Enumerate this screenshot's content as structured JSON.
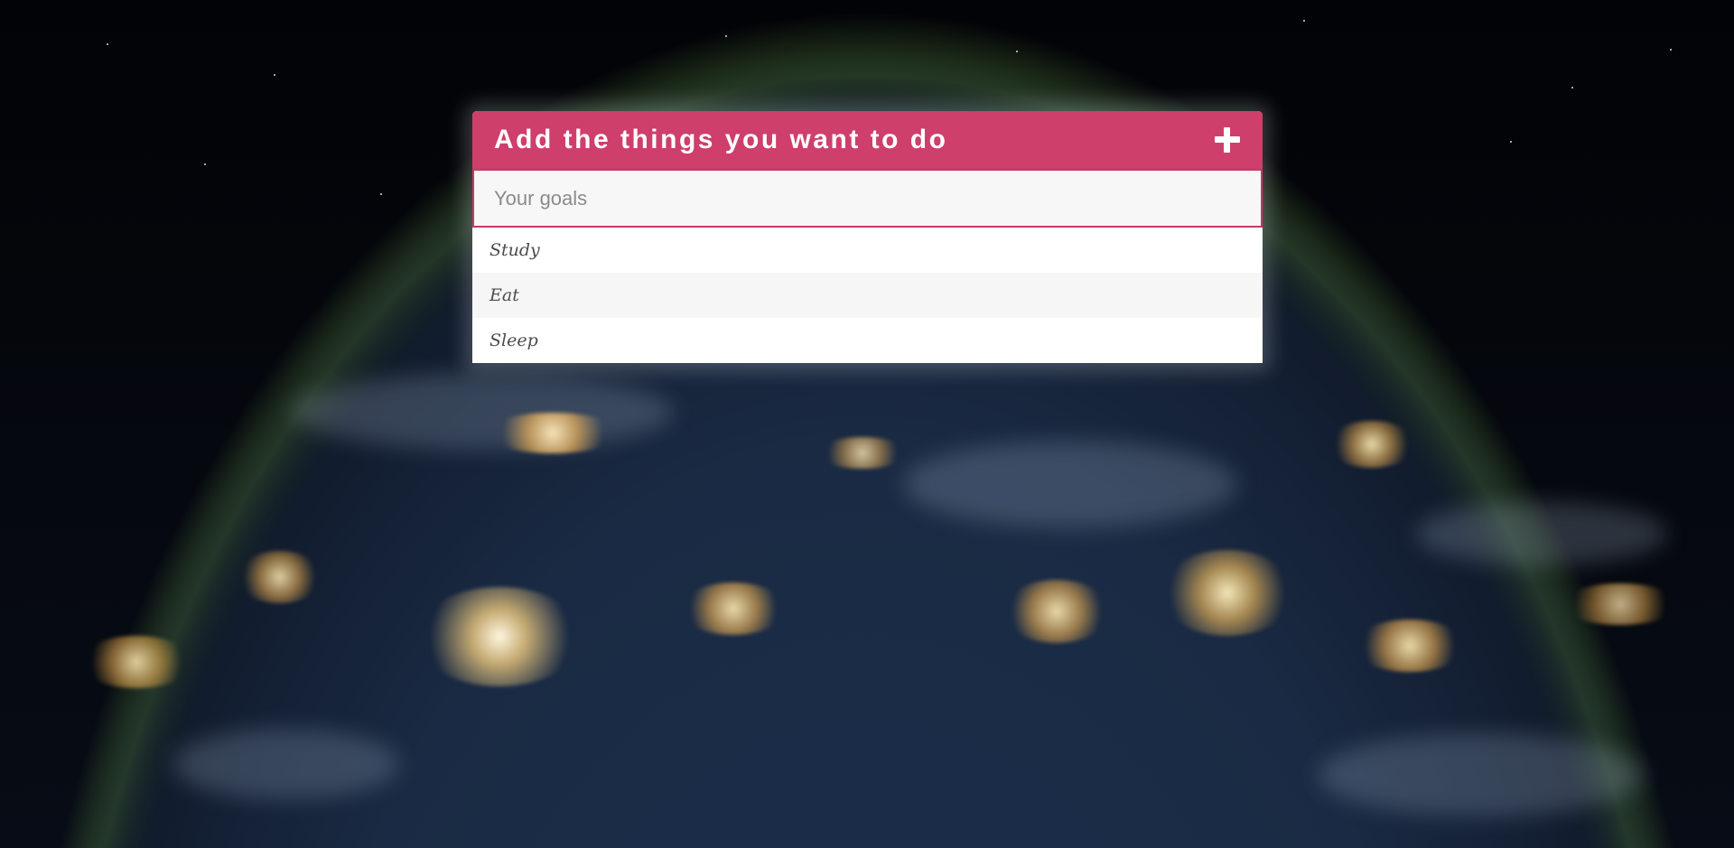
{
  "app": {
    "background_description_image": "night-earth-lights"
  },
  "todo": {
    "title": "Add the things you want to do",
    "add_icon": "plus-icon",
    "input": {
      "value": "",
      "placeholder": "Your goals"
    },
    "items": [
      {
        "label": "Study"
      },
      {
        "label": "Eat"
      },
      {
        "label": "Sleep"
      }
    ]
  },
  "colors": {
    "header": "#ce3f6b",
    "input_border": "#c43a67",
    "input_background": "#f7f7f7",
    "list_background": "#ffffff",
    "list_alt_background": "#f6f6f6"
  }
}
